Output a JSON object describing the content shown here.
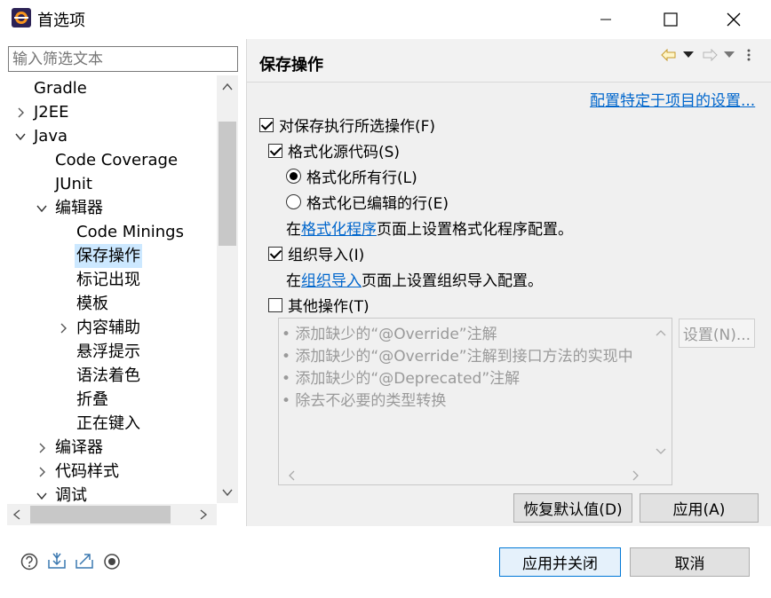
{
  "window": {
    "title": "首选项"
  },
  "filter": {
    "placeholder": "输入筛选文本"
  },
  "tree": {
    "items": [
      {
        "label": "Gradle"
      },
      {
        "label": "J2EE"
      },
      {
        "label": "Java"
      },
      {
        "label": "Code Coverage"
      },
      {
        "label": "JUnit"
      },
      {
        "label": "编辑器"
      },
      {
        "label": "Code Minings"
      },
      {
        "label": "保存操作"
      },
      {
        "label": "标记出现"
      },
      {
        "label": "模板"
      },
      {
        "label": "内容辅助"
      },
      {
        "label": "悬浮提示"
      },
      {
        "label": "语法着色"
      },
      {
        "label": "折叠"
      },
      {
        "label": "正在键入"
      },
      {
        "label": "编译器"
      },
      {
        "label": "代码样式"
      },
      {
        "label": "调试"
      }
    ]
  },
  "page": {
    "title": "保存操作",
    "project_link": "配置特定于项目的设置...",
    "perform_selected": "对保存执行所选操作(F)",
    "format_source": "格式化源代码(S)",
    "format_all": "格式化所有行(L)",
    "format_edited": "格式化已编辑的行(E)",
    "formatter_pre": "在",
    "formatter_link": "格式化程序",
    "formatter_post": "页面上设置格式化程序配置。",
    "organize_imports": "组织导入(I)",
    "organize_pre": "在",
    "organize_link": "组织导入",
    "organize_post": "页面上设置组织导入配置。",
    "additional": "其他操作(T)",
    "actions": [
      "• 添加缺少的“@Override”注解",
      "• 添加缺少的“@Override”注解到接口方法的实现中",
      "• 添加缺少的“@Deprecated”注解",
      "• 除去不必要的类型转换"
    ],
    "configure_button": "设置(N)...",
    "restore_defaults": "恢复默认值(D)",
    "apply": "应用(A)"
  },
  "footer": {
    "apply_close": "应用并关闭",
    "cancel": "取消"
  }
}
